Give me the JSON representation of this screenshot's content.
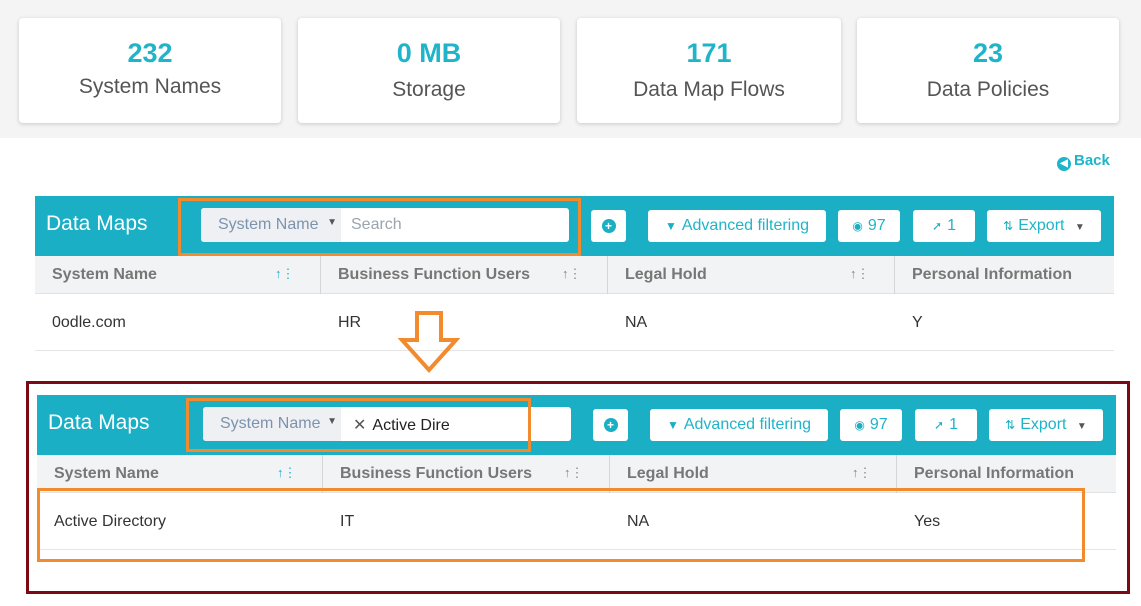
{
  "stats": [
    {
      "value": "232",
      "label": "System Names"
    },
    {
      "value": "0 MB",
      "label": "Storage"
    },
    {
      "value": "171",
      "label": "Data Map Flows"
    },
    {
      "value": "23",
      "label": "Data Policies"
    }
  ],
  "back_label": "Back",
  "colors": {
    "accent": "#1aafc4",
    "highlight": "#f28a2e",
    "frame": "#7c0a14"
  },
  "top_panel": {
    "title": "Data Maps",
    "search_select": "System Name",
    "search_placeholder": "Search",
    "advanced_filtering": "Advanced filtering",
    "hidden_count": "97",
    "pinned_count": "1",
    "export": "Export",
    "columns": [
      "System Name",
      "Business Function Users",
      "Legal Hold",
      "Personal Information"
    ],
    "row": [
      "0odle.com",
      "HR",
      "NA",
      "Y"
    ]
  },
  "bottom_panel": {
    "title": "Data Maps",
    "search_select": "System Name",
    "search_value": "Active Dire",
    "advanced_filtering": "Advanced filtering",
    "hidden_count": "97",
    "pinned_count": "1",
    "export": "Export",
    "columns": [
      "System Name",
      "Business Function Users",
      "Legal Hold",
      "Personal Information"
    ],
    "row": [
      "Active Directory",
      "IT",
      "NA",
      "Yes"
    ]
  }
}
